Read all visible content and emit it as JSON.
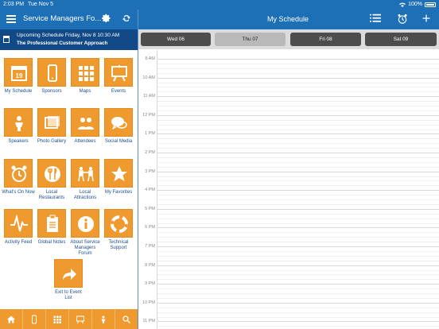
{
  "status_bar": {
    "time": "2:03 PM",
    "date": "Tue Nov 5",
    "battery": "100%"
  },
  "left_header": {
    "title": "Service Managers Fo..."
  },
  "upcoming": {
    "line1": "Upcoming Schedule Friday, Nov 8 10:30 AM",
    "line2": "The Professional Customer Approach"
  },
  "tiles": [
    {
      "label": "My Schedule",
      "icon": "calendar-icon",
      "badge": "19"
    },
    {
      "label": "Sponsors",
      "icon": "phone-icon"
    },
    {
      "label": "Maps",
      "icon": "grid-icon"
    },
    {
      "label": "Events",
      "icon": "easel-icon"
    },
    {
      "label": "Speakers",
      "icon": "speaker-icon"
    },
    {
      "label": "Photo Gallery",
      "icon": "photos-icon"
    },
    {
      "label": "Attendees",
      "icon": "people-icon"
    },
    {
      "label": "Social Media",
      "icon": "chat-icon"
    },
    {
      "label": "What's On Now",
      "icon": "alarm-clock-icon"
    },
    {
      "label": "Local Restaurants",
      "icon": "restaurant-icon"
    },
    {
      "label": "Local Attractions",
      "icon": "attractions-icon"
    },
    {
      "label": "My Favorites",
      "icon": "star-icon"
    },
    {
      "label": "Activity Feed",
      "icon": "activity-icon"
    },
    {
      "label": "Global Notes",
      "icon": "notes-icon"
    },
    {
      "label": "About Service Managers Forum",
      "icon": "info-icon"
    },
    {
      "label": "Technical Support",
      "icon": "lifebuoy-icon"
    },
    {
      "label": "Exit to Event List",
      "icon": "exit-arrow-icon"
    }
  ],
  "toolbar_icons": [
    "home-icon",
    "phone-icon",
    "grid-icon",
    "easel-icon",
    "speaker-icon",
    "search-icon"
  ],
  "right_header": {
    "title": "My Schedule"
  },
  "days": [
    {
      "label": "Wed 06",
      "selected": false
    },
    {
      "label": "Thu 07",
      "selected": true
    },
    {
      "label": "Fri 08",
      "selected": false
    },
    {
      "label": "Sat 09",
      "selected": false
    }
  ],
  "hours": [
    "8 AM",
    "10 AM",
    "11 AM",
    "12 PM",
    "1 PM",
    "2 PM",
    "3 PM",
    "4 PM",
    "5 PM",
    "6 PM",
    "7 PM",
    "8 PM",
    "9 PM",
    "10 PM",
    "11 PM"
  ],
  "colors": {
    "header_blue": "#1d6fb6",
    "dark_blue": "#114a86",
    "tile_orange": "#ef9a2e",
    "label_blue": "#1d4f8a"
  }
}
